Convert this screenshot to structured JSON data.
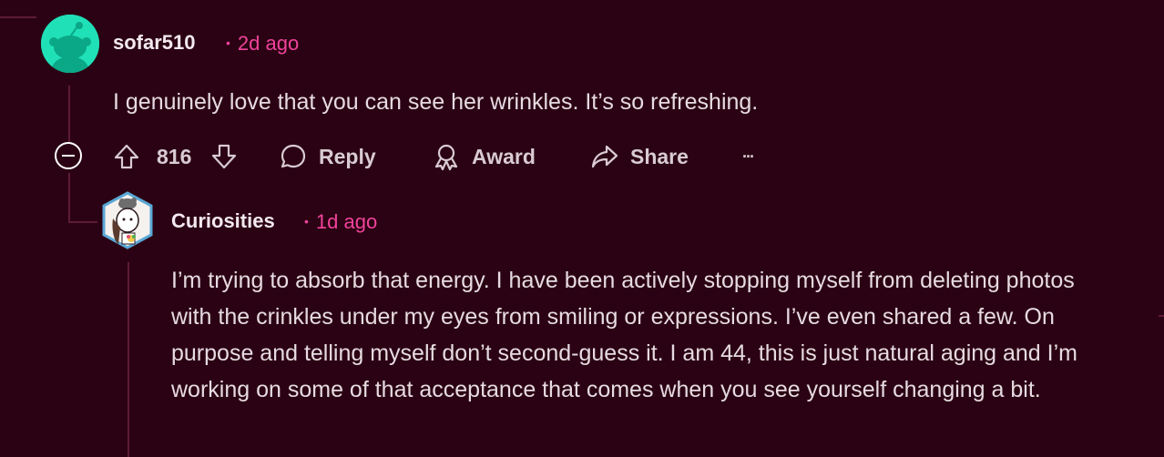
{
  "comments": [
    {
      "username": "sofar510",
      "time": "2d ago",
      "body": "I genuinely love that you can see her wrinkles. It’s so refreshing.",
      "avatar_icon": "snoo-avatar-icon"
    },
    {
      "username": "Curiosities",
      "time": "1d ago",
      "body": "I’m trying to absorb that energy. I have been actively stopping myself from deleting photos with the crinkles under my eyes from smiling or expressions. I’ve even shared a few. On purpose and telling myself don’t second-guess it. I am 44, this is just natural aging and I’m working on some of that acceptance that comes when you see yourself changing a bit.",
      "avatar_icon": "custom-avatar-icon"
    }
  ],
  "actions": {
    "vote_count": "816",
    "reply_label": "Reply",
    "award_label": "Award",
    "share_label": "Share",
    "more_label": "···"
  },
  "colors": {
    "background": "#2b0213",
    "timestamp": "#f0439b",
    "avatar_green": "#20e0b8",
    "thread_line": "#5c1b36"
  }
}
